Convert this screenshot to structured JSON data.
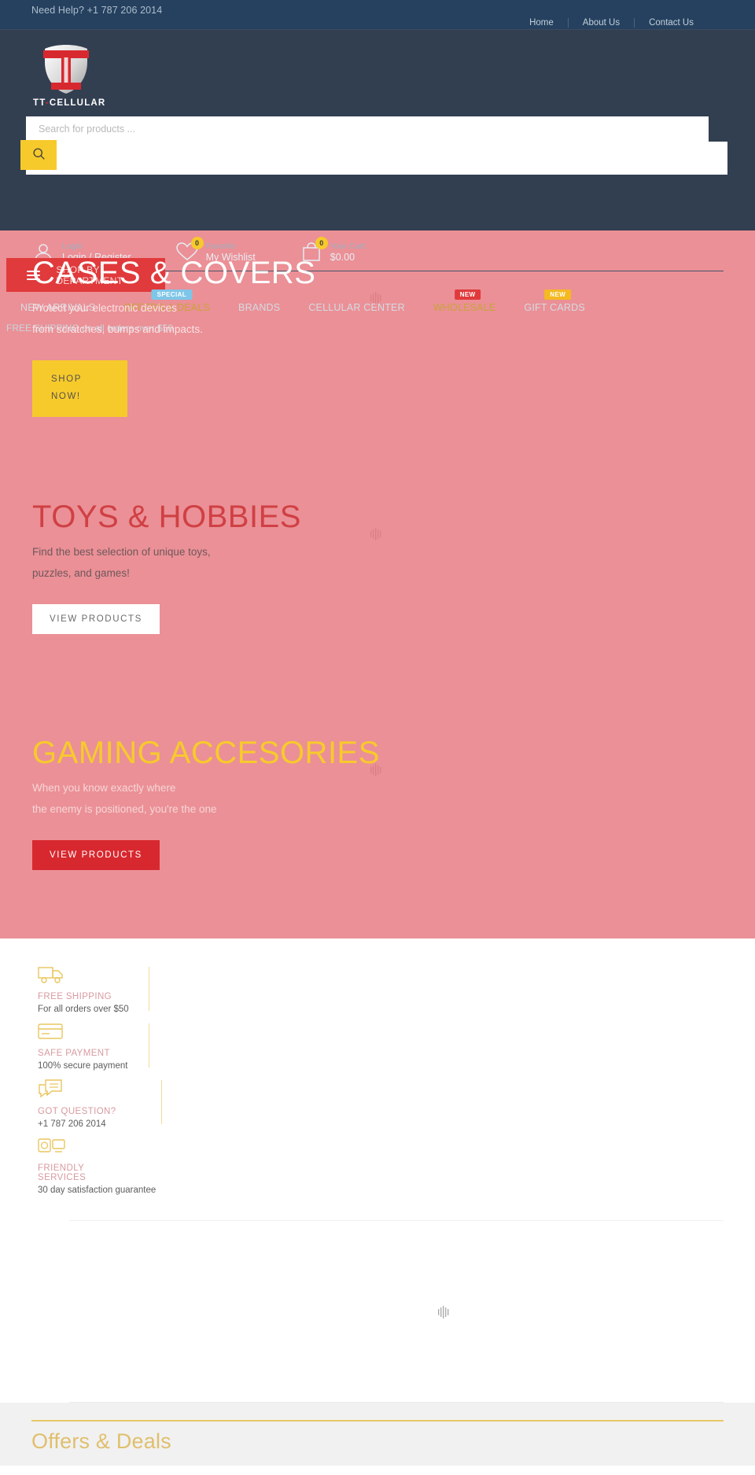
{
  "topbar": {
    "help_text": "Need Help? +1 787 206 2014",
    "links": [
      "Home",
      "About Us",
      "Contact Us"
    ]
  },
  "brand": {
    "name": "TT",
    "dash": "-",
    "suffix": "CELLULAR",
    "full_text": "TT-CELLULAR"
  },
  "search": {
    "placeholder": "Search for products ...",
    "value": "",
    "button_icon": "search-icon"
  },
  "account": [
    {
      "icon": "user-icon",
      "top": "Login",
      "bottom": "Login / Register",
      "badge": null
    },
    {
      "icon": "heart-icon",
      "top": "Favorite",
      "bottom": "My Wishlist",
      "badge": "0"
    },
    {
      "icon": "cart-icon",
      "top": "Your Cart:",
      "bottom": "$0.00",
      "badge": "0"
    }
  ],
  "department_button": {
    "label": "SHOP BY DEPARTMENT",
    "icon": "hamburger-icon"
  },
  "main_nav": [
    {
      "label": "NEW ARRIVALS",
      "badge": null,
      "badge_style": null,
      "amber": false
    },
    {
      "label": "OFFERS & DEALS",
      "badge": "SPECIAL",
      "badge_style": "special",
      "amber": true
    },
    {
      "label": "BRANDS",
      "badge": null,
      "badge_style": null,
      "amber": false
    },
    {
      "label": "CELLULAR CENTER",
      "badge": null,
      "badge_style": null,
      "amber": false
    },
    {
      "label": "WHOLESALE",
      "badge": "NEW",
      "badge_style": "new-red",
      "amber": true
    },
    {
      "label": "GIFT CARDS",
      "badge": "NEW",
      "badge_style": "new-yellow",
      "amber": false
    }
  ],
  "shipping_bar": "FREE SHIPPING on all orders over $50",
  "hero_slides": [
    {
      "title": "CASES & COVERS",
      "line1": "Protect your electronic devices",
      "line2": "from scratches, bumps and impacts.",
      "cta": "SHOP NOW!"
    },
    {
      "title": "TOYS & HOBBIES",
      "line1": "Find the best selection of unique toys,",
      "line2": "puzzles, and games!",
      "cta": "VIEW PRODUCTS"
    },
    {
      "title": "GAMING ACCESORIES",
      "line1": "When you know exactly where",
      "line2": "the enemy is positioned, you're the one",
      "cta": "VIEW PRODUCTS"
    }
  ],
  "features": [
    {
      "icon": "truck-icon",
      "title": "FREE SHIPPING",
      "sub": "For all orders over $50"
    },
    {
      "icon": "card-icon",
      "title": "SAFE PAYMENT",
      "sub": "100% secure payment"
    },
    {
      "icon": "chat-icon",
      "title": "GOT QUESTION?",
      "sub": "+1 787 206 2014"
    },
    {
      "icon": "support-icon",
      "title": "FRIENDLY SERVICES",
      "sub": "30 day satisfaction guarantee"
    }
  ],
  "offers_section": {
    "heading": "Offers & Deals"
  },
  "colors": {
    "topbar_bg": "#25415f",
    "header_bg": "#323f51",
    "accent_red": "#e03a3c",
    "accent_yellow": "#f7ca2c",
    "hero_bg": "#eb9096",
    "offers_heading": "#e0bf6d"
  }
}
